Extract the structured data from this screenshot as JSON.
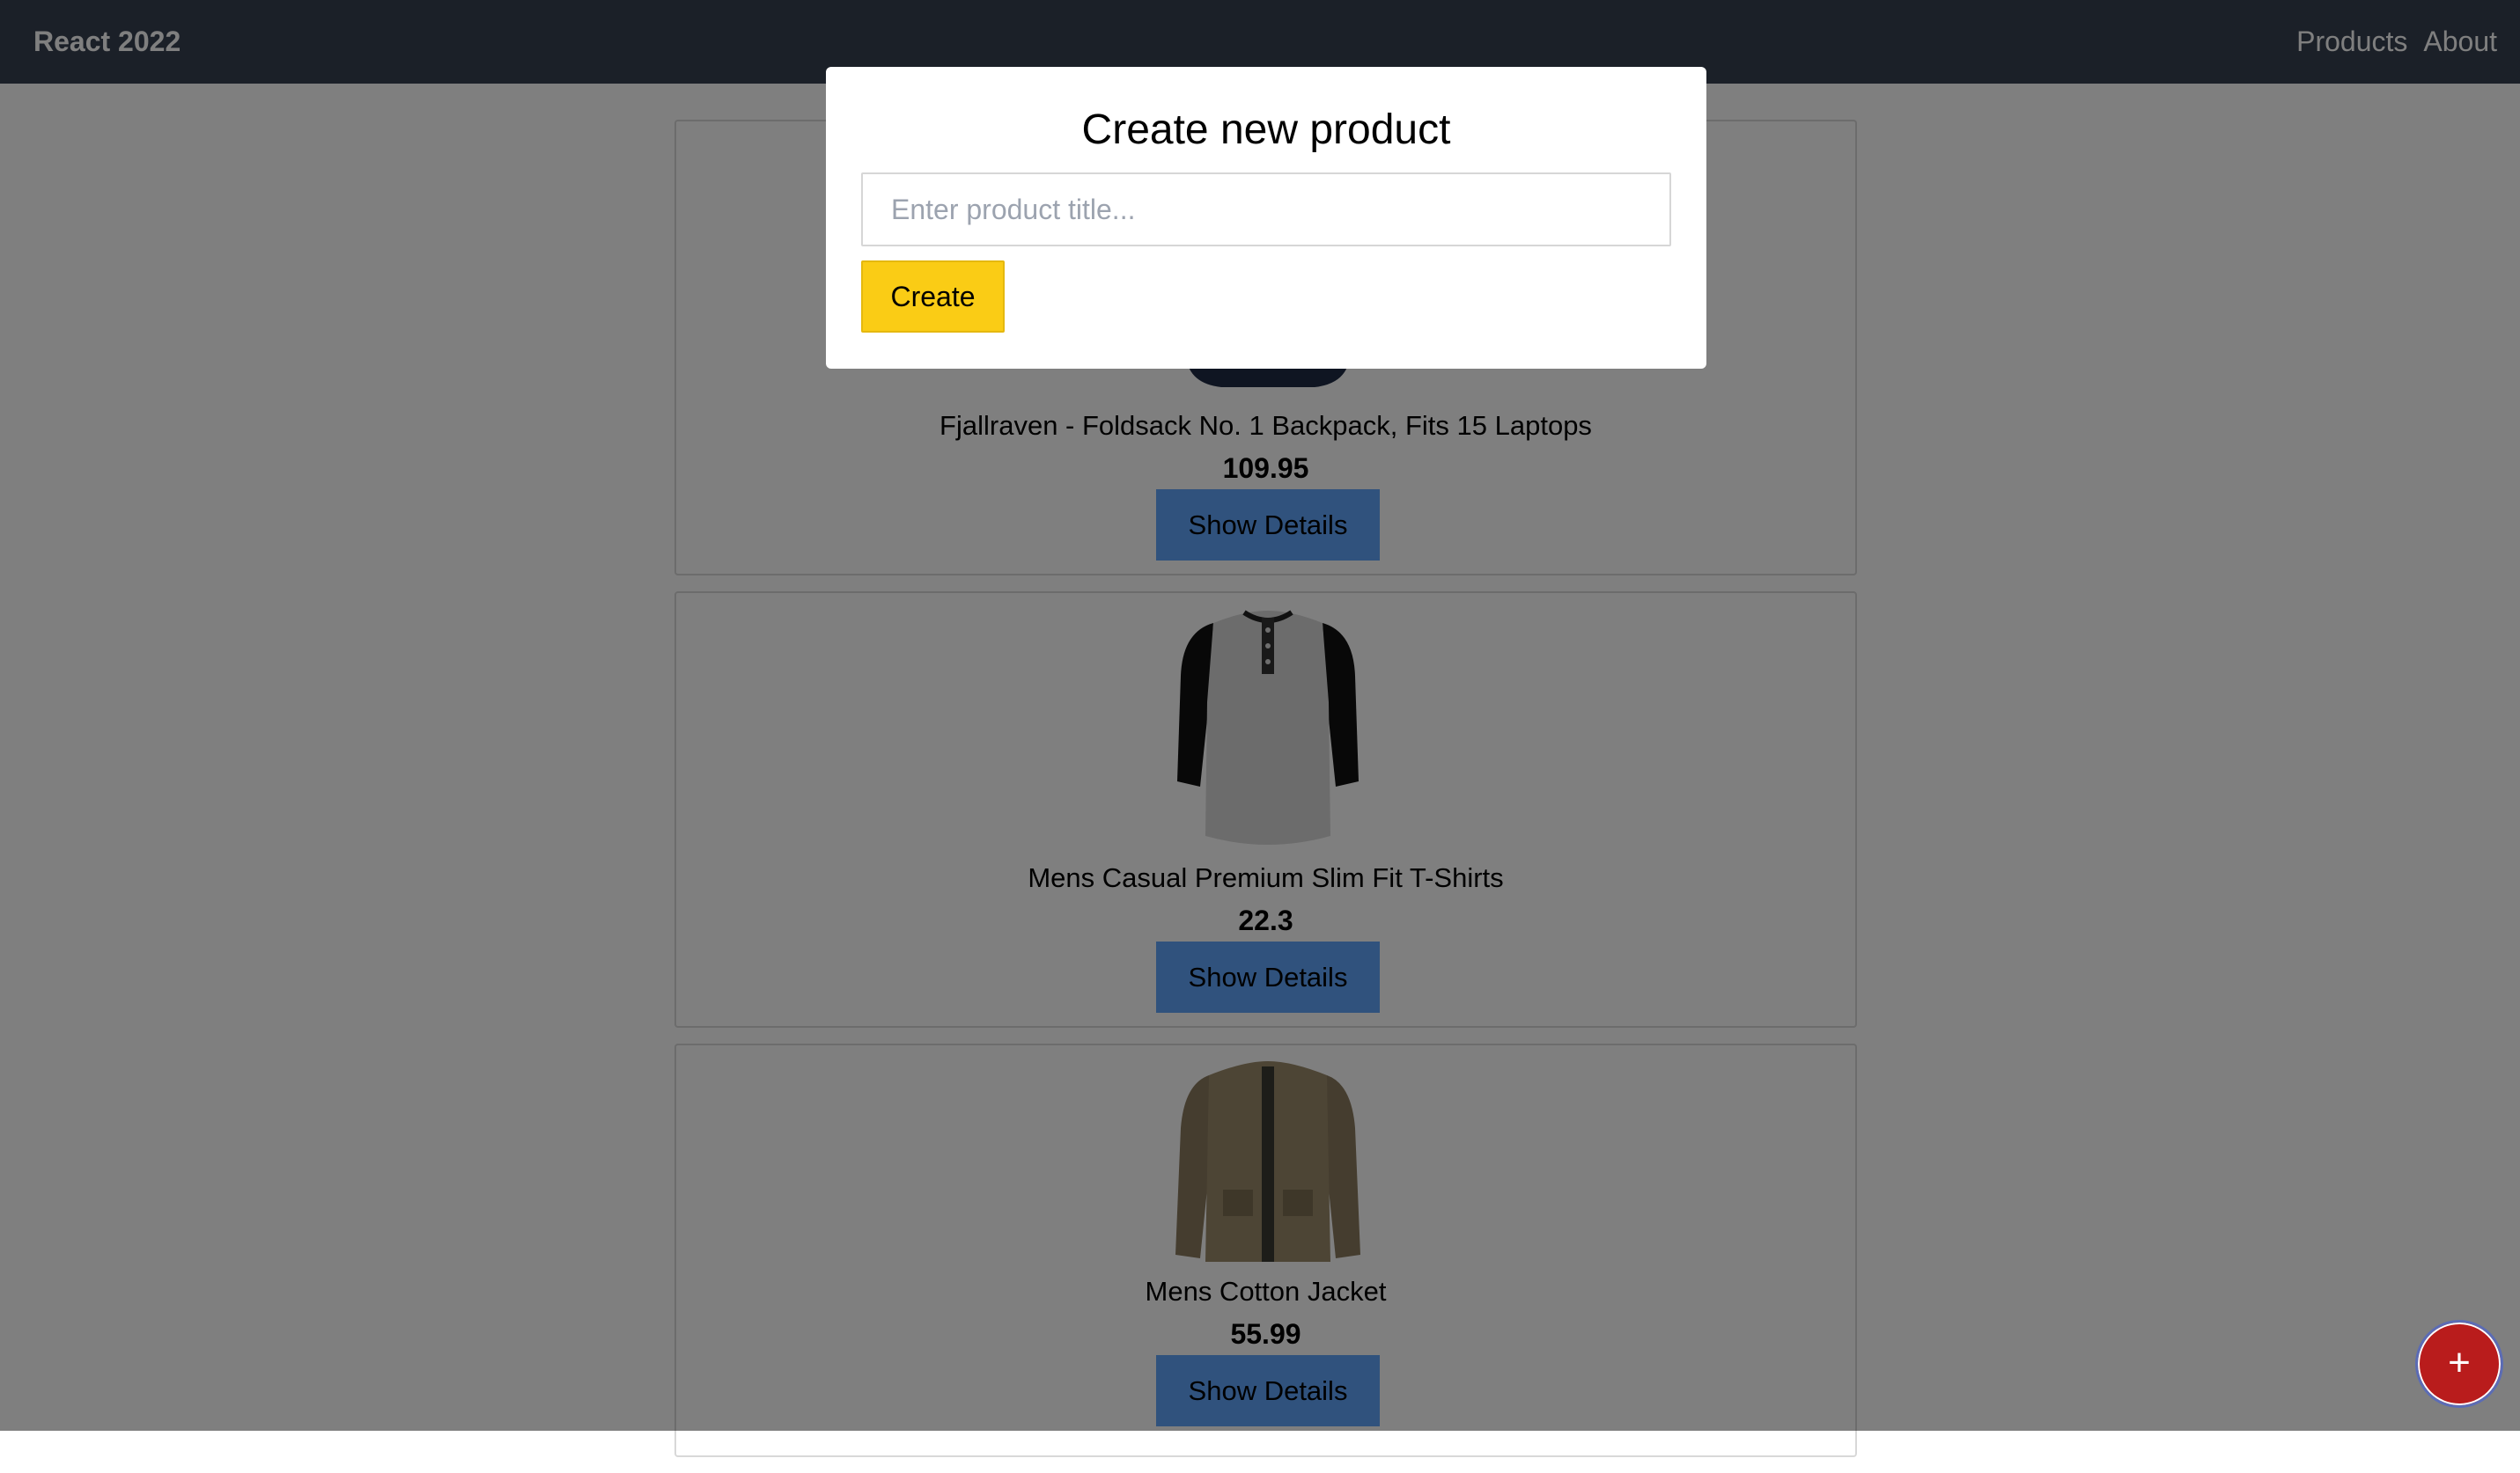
{
  "navbar": {
    "brand": "React 2022",
    "links": [
      "Products",
      "About"
    ]
  },
  "products": [
    {
      "title": "Fjallraven - Foldsack No. 1 Backpack, Fits 15 Laptops",
      "price": "109.95",
      "button": "Show Details",
      "image_icon": "backpack-image"
    },
    {
      "title": "Mens Casual Premium Slim Fit T-Shirts",
      "price": "22.3",
      "button": "Show Details",
      "image_icon": "tshirt-image"
    },
    {
      "title": "Mens Cotton Jacket",
      "price": "55.99",
      "button": "Show Details",
      "image_icon": "jacket-image"
    }
  ],
  "modal": {
    "title": "Create new product",
    "input_placeholder": "Enter product title...",
    "input_value": "",
    "create_label": "Create"
  },
  "fab": {
    "label": "+"
  },
  "colors": {
    "navbar": "#374151",
    "details_button": "#60a5fa",
    "create_button": "#facc15",
    "fab": "#b91c1c"
  }
}
